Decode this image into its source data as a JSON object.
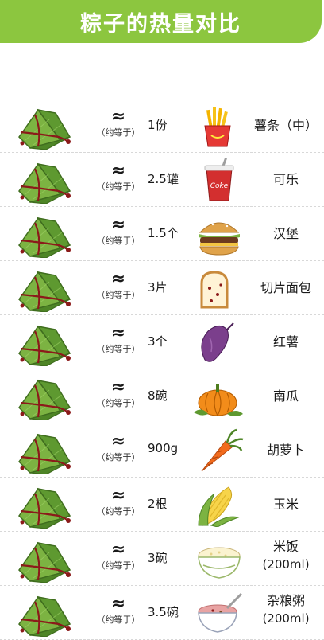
{
  "title": "粽子的热量对比",
  "approx_symbol": "≈",
  "approx_note": "（约等于）",
  "items": [
    {
      "qty": "1份",
      "food": "薯条（中）",
      "sub": "",
      "icon": "fries-icon"
    },
    {
      "qty": "2.5罐",
      "food": "可乐",
      "sub": "",
      "icon": "cola-icon"
    },
    {
      "qty": "1.5个",
      "food": "汉堡",
      "sub": "",
      "icon": "burger-icon"
    },
    {
      "qty": "3片",
      "food": "切片面包",
      "sub": "",
      "icon": "bread-icon"
    },
    {
      "qty": "3个",
      "food": "红薯",
      "sub": "",
      "icon": "sweet-potato-icon"
    },
    {
      "qty": "8碗",
      "food": "南瓜",
      "sub": "",
      "icon": "pumpkin-icon"
    },
    {
      "qty": "900g",
      "food": "胡萝卜",
      "sub": "",
      "icon": "carrot-icon"
    },
    {
      "qty": "2根",
      "food": "玉米",
      "sub": "",
      "icon": "corn-icon"
    },
    {
      "qty": "3碗",
      "food": "米饭",
      "sub": "(200ml)",
      "icon": "rice-bowl-icon"
    },
    {
      "qty": "3.5碗",
      "food": "杂粮粥",
      "sub": "(200ml)",
      "icon": "porridge-icon"
    }
  ],
  "colors": {
    "banner": "#8cc63f",
    "zongzi_leaf": "#6aa33a",
    "string": "#8b1a1a"
  }
}
